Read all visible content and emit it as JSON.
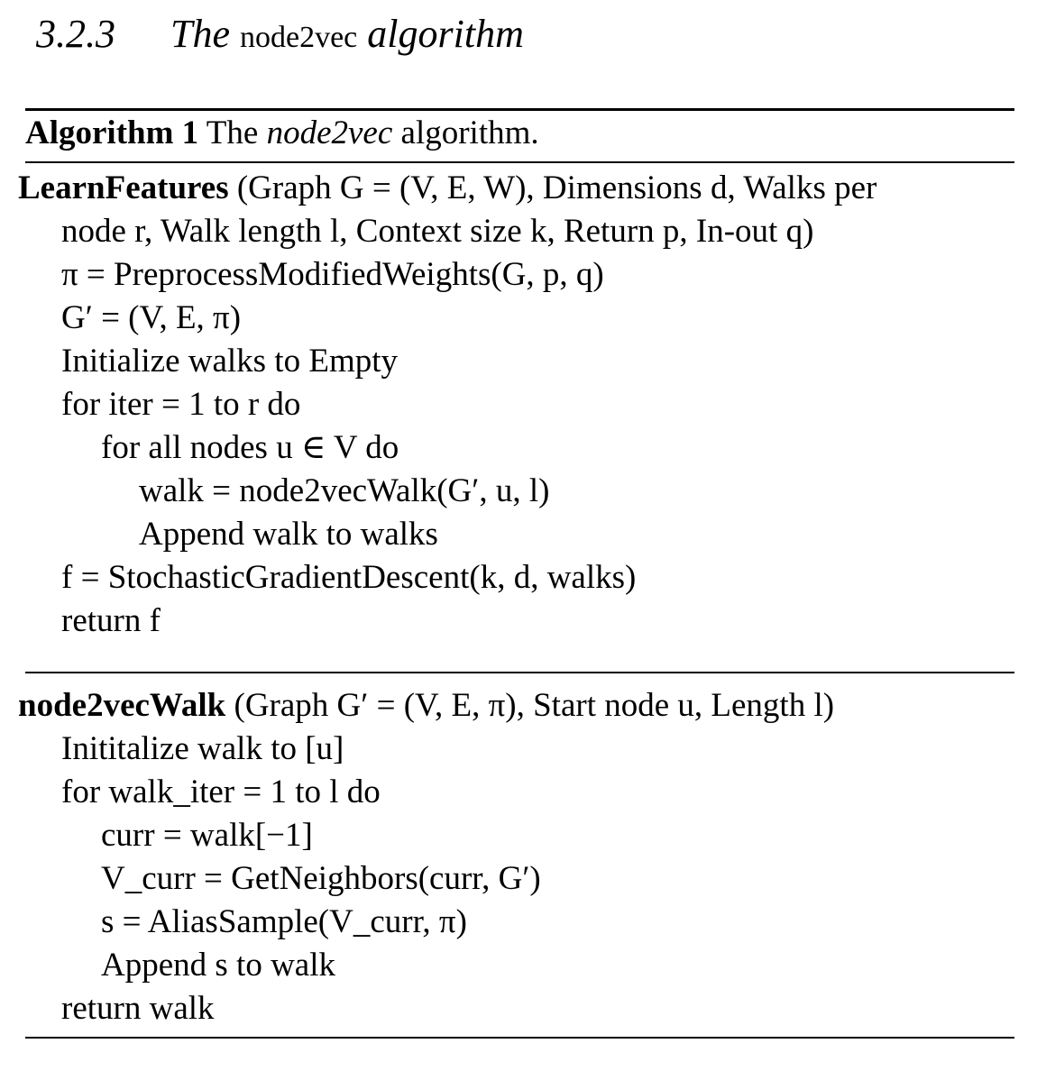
{
  "section": {
    "number": "3.2.3",
    "title_pre": "The",
    "title_upright": "node2vec",
    "title_post": "algorithm"
  },
  "algorithm": {
    "label": "Algorithm 1",
    "caption_pre": "The",
    "caption_italic": "node2vec",
    "caption_post": "algorithm."
  },
  "learn": {
    "name": "LearnFeatures",
    "sig_line1": "(Graph G = (V, E, W), Dimensions d, Walks per",
    "sig_line2": "node r, Walk length l, Context size k, Return p, In-out q)",
    "lines": [
      "π = PreprocessModifiedWeights(G, p, q)",
      "G′ = (V, E, π)",
      "Initialize walks to Empty",
      "for iter = 1 to r do",
      "for all nodes u ∈ V do",
      "walk = node2vecWalk(G′, u, l)",
      "Append walk to walks",
      "f = StochasticGradientDescent(k, d, walks)",
      "return f"
    ]
  },
  "walkproc": {
    "name": "node2vecWalk",
    "sig": "(Graph G′ = (V, E, π), Start node u, Length l)",
    "lines": [
      "Inititalize walk to [u]",
      "for walk_iter = 1 to l do",
      "curr = walk[−1]",
      "V_curr = GetNeighbors(curr, G′)",
      "s = AliasSample(V_curr, π)",
      "Append s to walk",
      "return walk"
    ]
  }
}
